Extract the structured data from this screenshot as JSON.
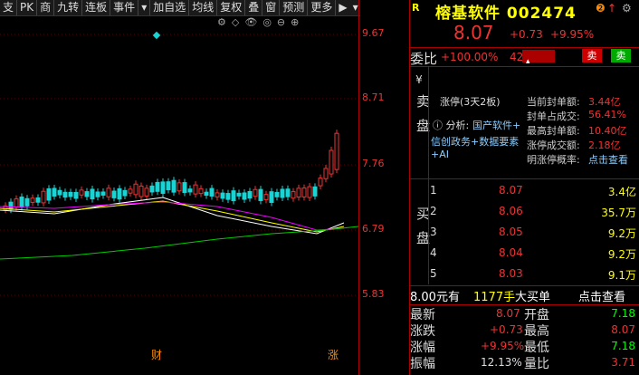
{
  "toolbar": {
    "buttons": [
      "支",
      "PK",
      "商",
      "九转",
      "连板",
      "事件",
      "▾",
      "加自选",
      "均线",
      "复权",
      "叠",
      "窗",
      "预测",
      "更多",
      "▶"
    ],
    "arrow_down": "▾",
    "arrow_up": "▴"
  },
  "chart": {
    "price_ticks": [
      "9.67",
      "8.71",
      "7.76",
      "6.79",
      "5.83"
    ],
    "bottom_labels": [
      "财",
      "涨"
    ],
    "icons": [
      "⚙",
      "◇",
      "👁",
      "◎",
      "⊖",
      "⊕"
    ]
  },
  "header": {
    "badge": "R",
    "title": "榕基软件 002474",
    "icon1": "❷",
    "icon2": "↑",
    "icon3": "⚙"
  },
  "price": {
    "last": "8.07",
    "change": "+0.73",
    "pct": "+9.95%"
  },
  "weibi": {
    "label": "委比",
    "value": "+100.00%",
    "amount": "42",
    "sell": "卖",
    "buy": "卖"
  },
  "limit": {
    "side_top": "¥",
    "side_label": "卖盘",
    "title": "涨停(3天2板)",
    "analysis_prefix": "分析:",
    "analysis_lines": [
      "国产软件+",
      "信创政务+数据要素",
      "+AI"
    ],
    "stats": [
      {
        "k": "当前封单额:",
        "v": "3.44亿"
      },
      {
        "k": "封单占成交:",
        "v": "56.41%"
      },
      {
        "k": "最高封单额:",
        "v": "10.40亿"
      },
      {
        "k": "涨停成交额:",
        "v": "2.18亿"
      },
      {
        "k": "明涨停概率:",
        "v": "点击查看"
      }
    ]
  },
  "book": {
    "side_label": "买盘",
    "rows": [
      {
        "n": "1",
        "p": "8.07",
        "v": "3.4亿"
      },
      {
        "n": "2",
        "p": "8.06",
        "v": "35.7万"
      },
      {
        "n": "3",
        "p": "8.05",
        "v": "9.2万"
      },
      {
        "n": "4",
        "p": "8.04",
        "v": "9.2万"
      },
      {
        "n": "5",
        "p": "8.03",
        "v": "9.1万"
      }
    ]
  },
  "foot": {
    "price": "8.00元有",
    "qty": "1177手",
    "big": "大买单",
    "check": "点击查看"
  },
  "stats": [
    {
      "l1": "最新",
      "v1": "8.07",
      "l2": "开盘",
      "v2": "7.18"
    },
    {
      "l1": "涨跌",
      "v1": "+0.73",
      "l2": "最高",
      "v2": "8.07"
    },
    {
      "l1": "涨幅",
      "v1": "+9.95%",
      "l2": "最低",
      "v2": "7.18"
    },
    {
      "l1": "振幅",
      "v1": "12.13%",
      "l2": "量比",
      "v2": "3.71"
    }
  ],
  "colors": {
    "up": "#e33",
    "down": "#19d4d4",
    "ma1": "#fff",
    "ma2": "#ff0",
    "ma3": "#e0f",
    "ma4": "#0c0",
    "accent": "#ff0"
  }
}
